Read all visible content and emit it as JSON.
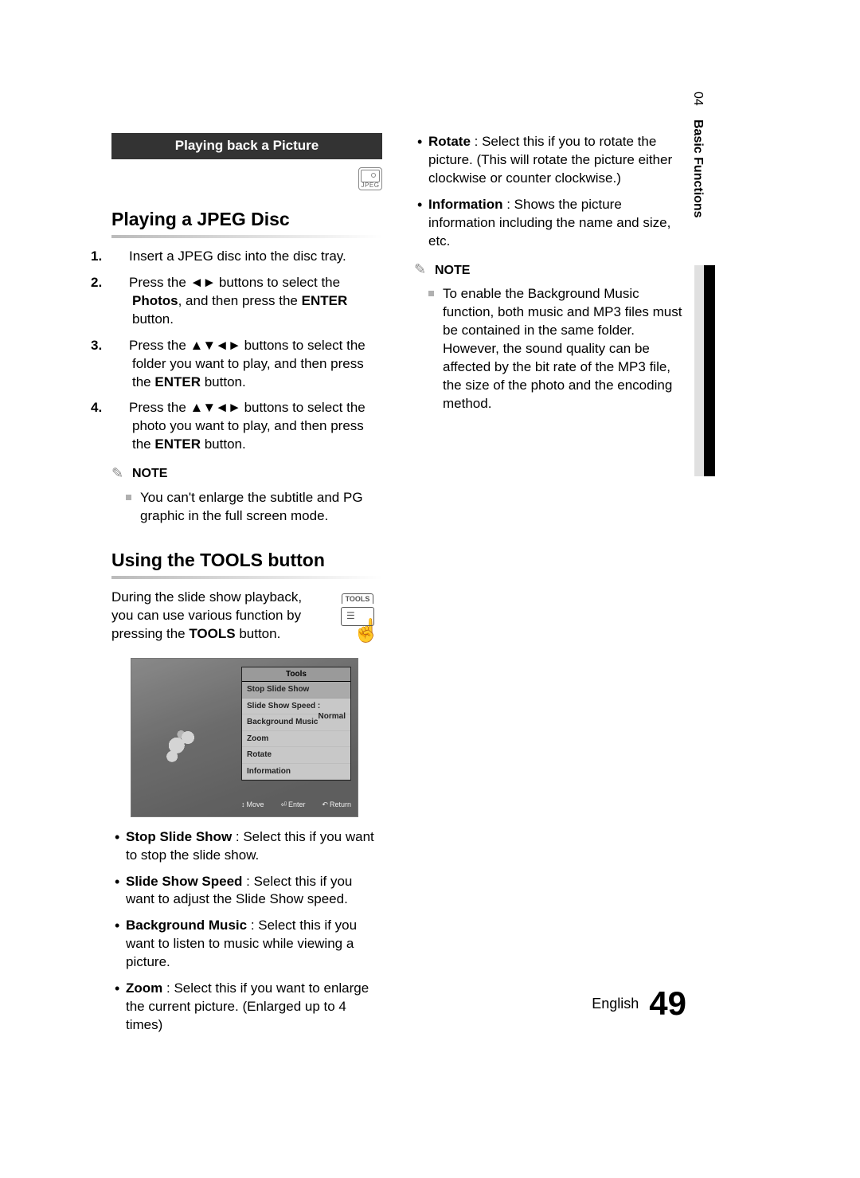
{
  "side_tab": {
    "num": "04",
    "name": "Basic Functions"
  },
  "section_banner": "Playing back a Picture",
  "jpeg_badge": "JPEG",
  "heading_jpeg": "Playing a JPEG Disc",
  "steps": [
    {
      "num": "1.",
      "text_a": "Insert a JPEG disc into the disc tray."
    },
    {
      "num": "2.",
      "text_a": "Press the ",
      "arrows": "◄►",
      "text_b": " buttons to select the ",
      "bold": "Photos",
      "text_c": ", and then press the ",
      "bold2": "ENTER",
      "text_d": " button."
    },
    {
      "num": "3.",
      "text_a": "Press the ",
      "arrows": "▲▼◄►",
      "text_b": " buttons to select the folder you want to play, and then press the ",
      "bold": "ENTER",
      "text_c": " button."
    },
    {
      "num": "4.",
      "text_a": "Press the ",
      "arrows": "▲▼◄►",
      "text_b": " buttons to select the photo you want to play, and then press the ",
      "bold": "ENTER",
      "text_c": " button."
    }
  ],
  "note_label": "NOTE",
  "note1_items": [
    "You can't enlarge the subtitle and PG graphic in the full screen mode."
  ],
  "heading_tools": "Using the TOOLS button",
  "tools_intro": {
    "pre": "During the slide show playback, you can use various function by pressing the ",
    "bold": "TOOLS",
    "post": " button."
  },
  "tools_btn_label": "TOOLS",
  "tools_menu": {
    "header": "Tools",
    "items": [
      {
        "label": "Stop Slide Show",
        "value": ""
      },
      {
        "label": "Slide Show Speed  :",
        "value": "Normal"
      },
      {
        "label": "Background Music",
        "value": ""
      },
      {
        "label": "Zoom",
        "value": ""
      },
      {
        "label": "Rotate",
        "value": ""
      },
      {
        "label": "Information",
        "value": ""
      }
    ],
    "osd": {
      "move": "Move",
      "enter": "Enter",
      "ret": "Return"
    }
  },
  "bullets_left": [
    {
      "term": "Stop Slide Show",
      "desc": " : Select this if you want to stop the slide show."
    },
    {
      "term": "Slide Show Speed",
      "desc": " : Select this if you want to adjust the Slide Show speed."
    },
    {
      "term": "Background Music",
      "desc": " : Select this if you want to listen to music while viewing a picture."
    },
    {
      "term": "Zoom",
      "desc": " : Select this if you want to enlarge the current picture. (Enlarged up to 4 times)"
    }
  ],
  "bullets_right": [
    {
      "term": "Rotate",
      "desc": " : Select this if you to rotate the picture. (This will rotate the picture either clockwise or counter clockwise.)"
    },
    {
      "term": "Information",
      "desc": " : Shows the picture information including the name and size, etc."
    }
  ],
  "note2_items": [
    "To enable the Background Music function, both music and MP3 files must be contained in the same folder. However, the sound quality can be affected by the bit rate of the MP3 file, the size of the photo and the encoding method."
  ],
  "footer": {
    "lang": "English",
    "page": "49"
  }
}
